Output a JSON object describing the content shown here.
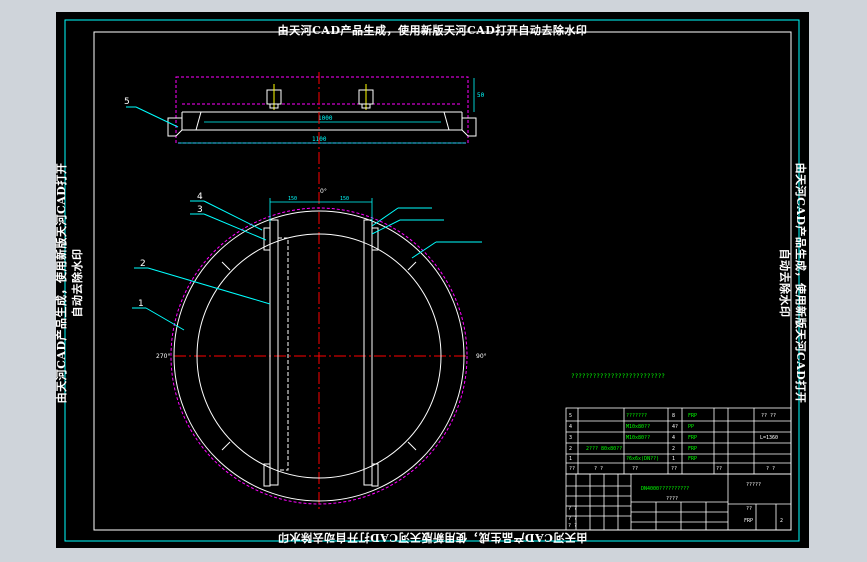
{
  "watermark": {
    "top": "由天河CAD产品生成，使用新版天河CAD打开自动去除水印",
    "bottom": "由天河CAD产品生成，使用新版天河CAD打开自动去除水印",
    "left": "由天河CAD产品生成，使用新版天河CAD打开自动去除水印",
    "right": "由天河CAD产品生成，使用新版天河CAD打开自动去除水印"
  },
  "callouts": {
    "c1": "1",
    "c2": "2",
    "c3": "3",
    "c4": "4",
    "c5": "5"
  },
  "angles": {
    "a0": "0°",
    "a90": "90°",
    "a270": "270°"
  },
  "dims": {
    "d1": "1000",
    "d2": "1100",
    "d3": "50",
    "d4": "150",
    "d5": "150"
  },
  "notes": {
    "n1": "??????????????????????????",
    "n2": "???????????",
    "n3": "???????????"
  },
  "bom": [
    {
      "no": "5",
      "name": "???????",
      "qty": "8",
      "mat": "FRP",
      "note": "?? ??"
    },
    {
      "no": "4",
      "name": "M10x80??",
      "qty": "4?",
      "mat": "PP",
      "note": ""
    },
    {
      "no": "3",
      "name": "M10x80??",
      "qty": "4",
      "mat": "FRP",
      "note": "L=1360"
    },
    {
      "no": "2",
      "name": "2??? 80x80??",
      "qty": "2",
      "mat": "FRP",
      "note": ""
    },
    {
      "no": "1",
      "name": "?6x6x(DN??)",
      "qty": "1",
      "mat": "FRP",
      "note": ""
    }
  ],
  "bom_header": {
    "no": "??",
    "name": "? ?",
    "qty": "??",
    "mat": "? ?",
    "wt": "??",
    "note": "? ?"
  },
  "title_block": {
    "project": "DN4000??????????",
    "drawing": "????",
    "name": "?????",
    "material": "FRP",
    "sheet": "2",
    "scale": "??",
    "r1": "? ?",
    "r2": "? ?",
    "r3": "? ?"
  },
  "colors": {
    "frame": "#00ffff",
    "outline": "#ffffff",
    "dashed": "#ff00ff",
    "center": "#ff0000",
    "dim": "#00ffff",
    "note": "#00ff00",
    "yellow": "#ffff00"
  }
}
